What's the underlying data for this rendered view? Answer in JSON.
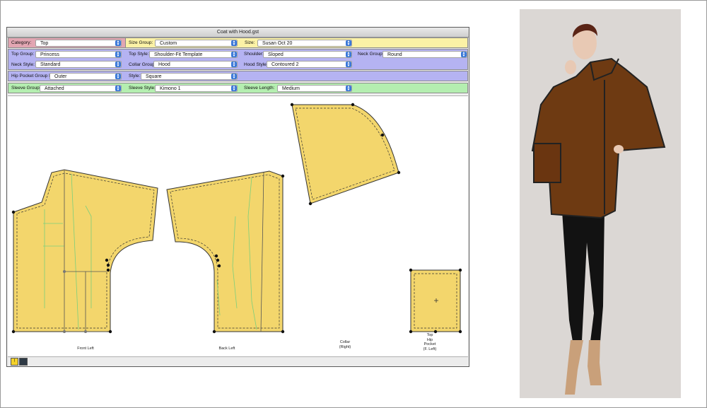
{
  "window_title": "Coat with Hood.gst",
  "rows": {
    "category": {
      "label": "Category:",
      "value": "Top",
      "color": "#e2a6b2"
    },
    "size_group": {
      "label": "Size Group:",
      "value": "Custom",
      "color": "#fbf2a6"
    },
    "size": {
      "label": "Size:",
      "value": "Susan Oct 20"
    },
    "top_group": {
      "label": "Top Group:",
      "value": "Princess",
      "color": "#b5b3f2"
    },
    "top_style": {
      "label": "Top Style:",
      "value": "Shoulder-Fit Template"
    },
    "shoulder": {
      "label": "Shoulder:",
      "value": "Sloped"
    },
    "neck_group": {
      "label": "Neck Group:",
      "value": "Round"
    },
    "neck_style": {
      "label": "Neck Style:",
      "value": "Standard"
    },
    "collar_group": {
      "label": "Collar Group:",
      "value": "Hood"
    },
    "hood_style": {
      "label": "Hood Style:",
      "value": "Contoured 2"
    },
    "hip_pocket_group": {
      "label": "Hip Pocket Group F:",
      "value": "Outer"
    },
    "style": {
      "label": "Style:",
      "value": "Square"
    },
    "sleeve_group": {
      "label": "Sleeve Group:",
      "value": "Attached",
      "color": "#b4eeb0"
    },
    "sleeve_style": {
      "label": "Sleeve Style:",
      "value": "Kimono 1"
    },
    "sleeve_length": {
      "label": "Sleeve Length:",
      "value": "Medium"
    }
  },
  "pieces": {
    "front_left": "Front Left",
    "back_left": "Back Left",
    "collar": "Collar\n(Right)",
    "pocket": "Top\nHip\nPocket\n(F. Left)"
  },
  "colors": {
    "piece_fill": "#f3d66c",
    "piece_stroke": "#333333",
    "guide": "#7ccf7c",
    "coat": "#6e3a12"
  },
  "icons": [
    "warning-icon",
    "grid-icon",
    "popup-arrow-icon"
  ]
}
